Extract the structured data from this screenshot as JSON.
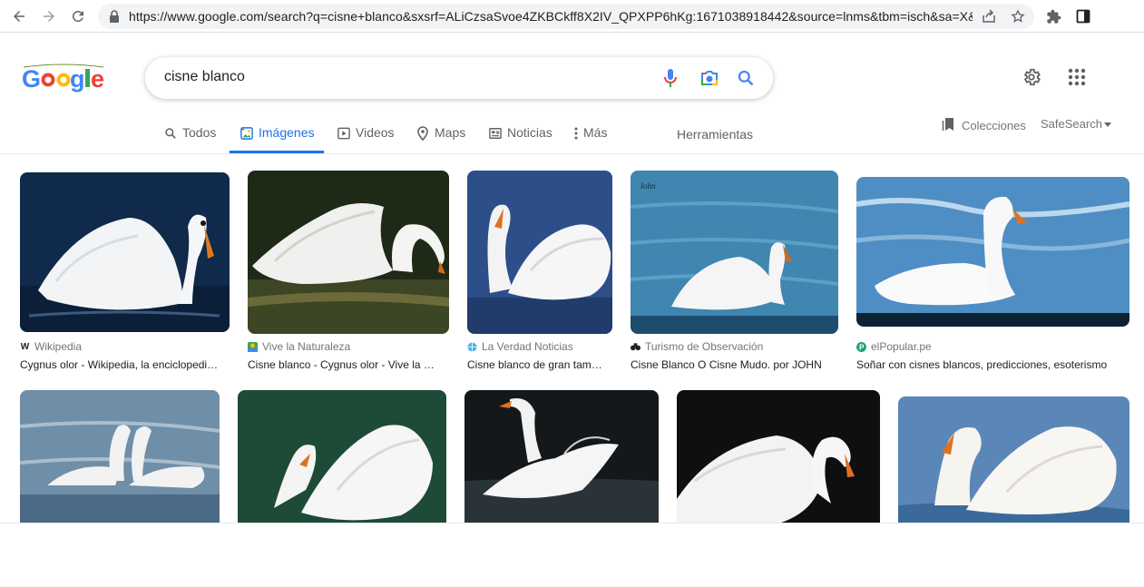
{
  "browser": {
    "url": "https://www.google.com/search?q=cisne+blanco&sxsrf=ALiCzsaSvoe4ZKBCkff8X2IV_QPXPP6hKg:1671038918442&source=lnms&tbm=isch&sa=X&..."
  },
  "search": {
    "query": "cisne blanco"
  },
  "tabs": [
    {
      "label": "Todos",
      "icon": "search-icon"
    },
    {
      "label": "Imágenes",
      "icon": "image-icon",
      "active": true
    },
    {
      "label": "Videos",
      "icon": "play-icon"
    },
    {
      "label": "Maps",
      "icon": "map-pin-icon"
    },
    {
      "label": "Noticias",
      "icon": "newspaper-icon"
    },
    {
      "label": "Más",
      "icon": "more-vert-icon"
    }
  ],
  "tools_label": "Herramientas",
  "collections_label": "Colecciones",
  "safesearch_label": "SafeSearch",
  "results": [
    {
      "source": "Wikipedia",
      "title": "Cygnus olor - Wikipedia, la enciclopedia libre"
    },
    {
      "source": "Vive la Naturaleza",
      "title": "Cisne blanco - Cygnus olor - Vive la Naturaleza"
    },
    {
      "source": "La Verdad Noticias",
      "title": "Cisne blanco de gran tamaño"
    },
    {
      "source": "Turismo de Observación",
      "title": "Cisne Blanco O Cisne Mudo. por JOHN"
    },
    {
      "source": "elPopular.pe",
      "title": "Soñar con cisnes blancos, predicciones, esoterismo"
    }
  ],
  "colors": {
    "accent": "#1a73e8",
    "google_blue": "#4285f4",
    "google_red": "#ea4335",
    "google_yellow": "#fbbc05",
    "google_green": "#34a853"
  }
}
